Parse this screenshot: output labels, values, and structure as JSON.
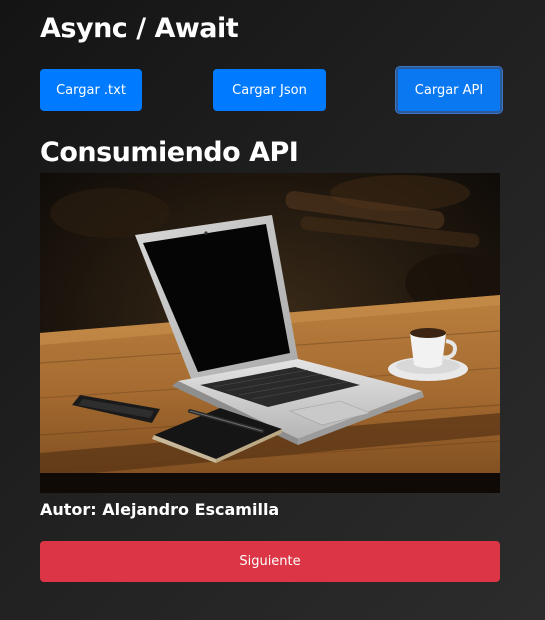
{
  "header": {
    "title": "Async / Await"
  },
  "toolbar": {
    "load_txt_label": "Cargar .txt",
    "load_json_label": "Cargar Json",
    "load_api_label": "Cargar API"
  },
  "content": {
    "section_title": "Consumiendo API",
    "image": {
      "subject": "laptop-on-wooden-table-photo"
    },
    "author_text": "Autor: Alejandro Escamilla"
  },
  "actions": {
    "next_label": "Siguiente"
  },
  "colors": {
    "primary": "#007bff",
    "danger": "#dc3545",
    "background": "#1e1e1e"
  }
}
